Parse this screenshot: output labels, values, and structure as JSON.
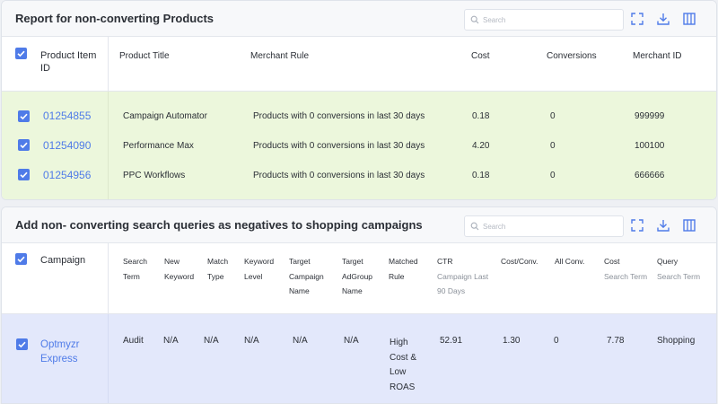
{
  "report1": {
    "title": "Report for non-converting Products",
    "search_placeholder": "Search",
    "columns": {
      "product_item_id_line1": "Product Item",
      "product_item_id_line2": "ID",
      "product_title": "Product Title",
      "merchant_rule": "Merchant Rule",
      "cost": "Cost",
      "conversions": "Conversions",
      "merchant_id": "Merchant ID"
    },
    "rows": [
      {
        "id": "01254855",
        "title": "Campaign Automator",
        "rule": "Products with 0 conversions in last 30 days",
        "cost": "0.18",
        "conversions": "0",
        "merchant_id": "999999"
      },
      {
        "id": "01254090",
        "title": "Performance Max",
        "rule": "Products with 0 conversions in last 30 days",
        "cost": "4.20",
        "conversions": "0",
        "merchant_id": "100100"
      },
      {
        "id": "01254956",
        "title": "PPC Workflows",
        "rule": "Products with 0 conversions in last 30 days",
        "cost": "0.18",
        "conversions": "0",
        "merchant_id": "666666"
      }
    ],
    "colors": {
      "highlight": "#ecf7dc"
    }
  },
  "report2": {
    "title": "Add non- converting search queries as negatives to shopping campaigns",
    "search_placeholder": "Search",
    "columns": {
      "campaign": "Campaign",
      "search_term": [
        "Search",
        "Term"
      ],
      "new_keyword": [
        "New",
        "Keyword"
      ],
      "match_type": [
        "Match",
        "Type"
      ],
      "keyword_level": [
        "Keyword",
        "Level"
      ],
      "target_campaign_name": [
        "Target",
        "Campaign",
        "Name"
      ],
      "target_adgroup_name": [
        "Target",
        "AdGroup",
        "Name"
      ],
      "matched_rule": [
        "Matched",
        "Rule"
      ],
      "ctr": "CTR",
      "ctr_sub": [
        "Campaign Last",
        "90 Days"
      ],
      "cost_conv": "Cost/Conv.",
      "all_conv": "All Conv.",
      "cost": "Cost",
      "cost_sub": "Search Term",
      "query": "Query",
      "query_sub": "Search Term"
    },
    "row": {
      "campaign": [
        "Optmyzr",
        "Express"
      ],
      "search_term": "Audit",
      "new_keyword": "N/A",
      "match_type": "N/A",
      "keyword_level": "N/A",
      "target_campaign_name": "N/A",
      "target_adgroup_name": "N/A",
      "matched_rule": [
        "High",
        "Cost &",
        "Low",
        "ROAS"
      ],
      "ctr": "52.91",
      "cost_conv": "1.30",
      "all_conv": "0",
      "cost": "7.78",
      "query": "Shopping"
    },
    "colors": {
      "highlight": "#e3e8fb"
    }
  },
  "icons": [
    "search-icon",
    "expand-icon",
    "download-icon",
    "columns-icon",
    "check-icon"
  ],
  "accent": "#4f7be8"
}
